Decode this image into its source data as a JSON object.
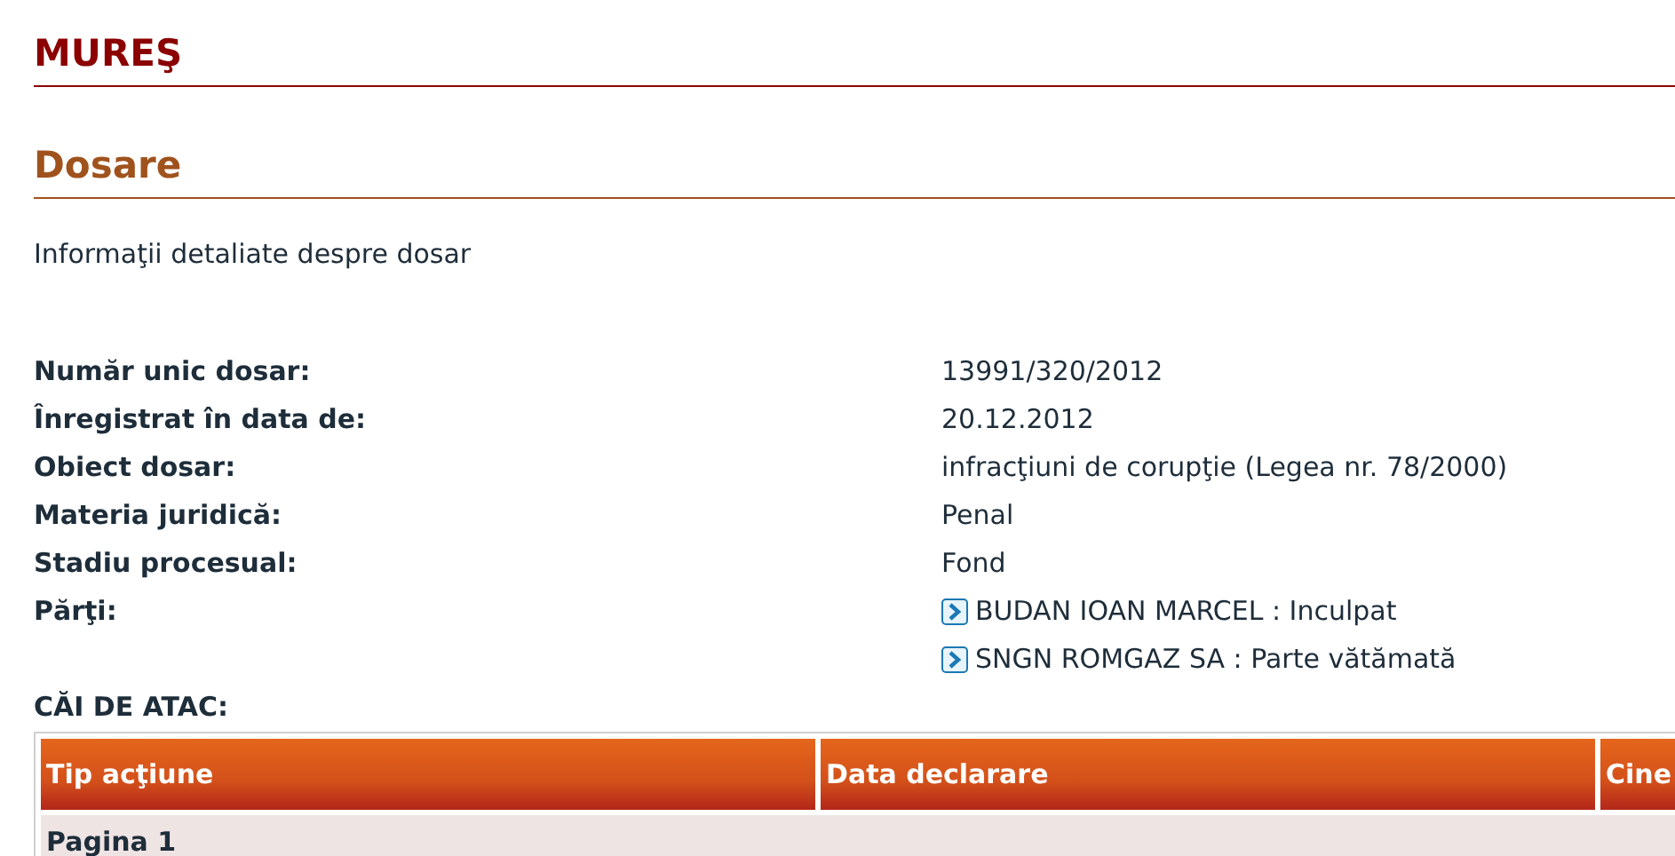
{
  "court": "MUREŞ",
  "section": "Dosare",
  "intro": "Informaţii detaliate despre dosar",
  "fields": [
    {
      "label": "Număr unic dosar:",
      "value": "13991/320/2012"
    },
    {
      "label": "Înregistrat în data de:",
      "value": "20.12.2012"
    },
    {
      "label": "Obiect dosar:",
      "value": "infracţiuni de corupţie (Legea nr. 78/2000)"
    },
    {
      "label": "Materia juridică:",
      "value": "Penal"
    },
    {
      "label": "Stadiu procesual:",
      "value": "Fond"
    }
  ],
  "parties": {
    "label": "Părţi:",
    "items": [
      "BUDAN IOAN MARCEL : Inculpat",
      "SNGN ROMGAZ SA : Parte vătămată"
    ]
  },
  "appeals": {
    "label": "CĂI DE ATAC:",
    "columns": [
      "Tip acţiune",
      "Data declarare",
      "Cine"
    ],
    "footer": "Pagina 1"
  }
}
